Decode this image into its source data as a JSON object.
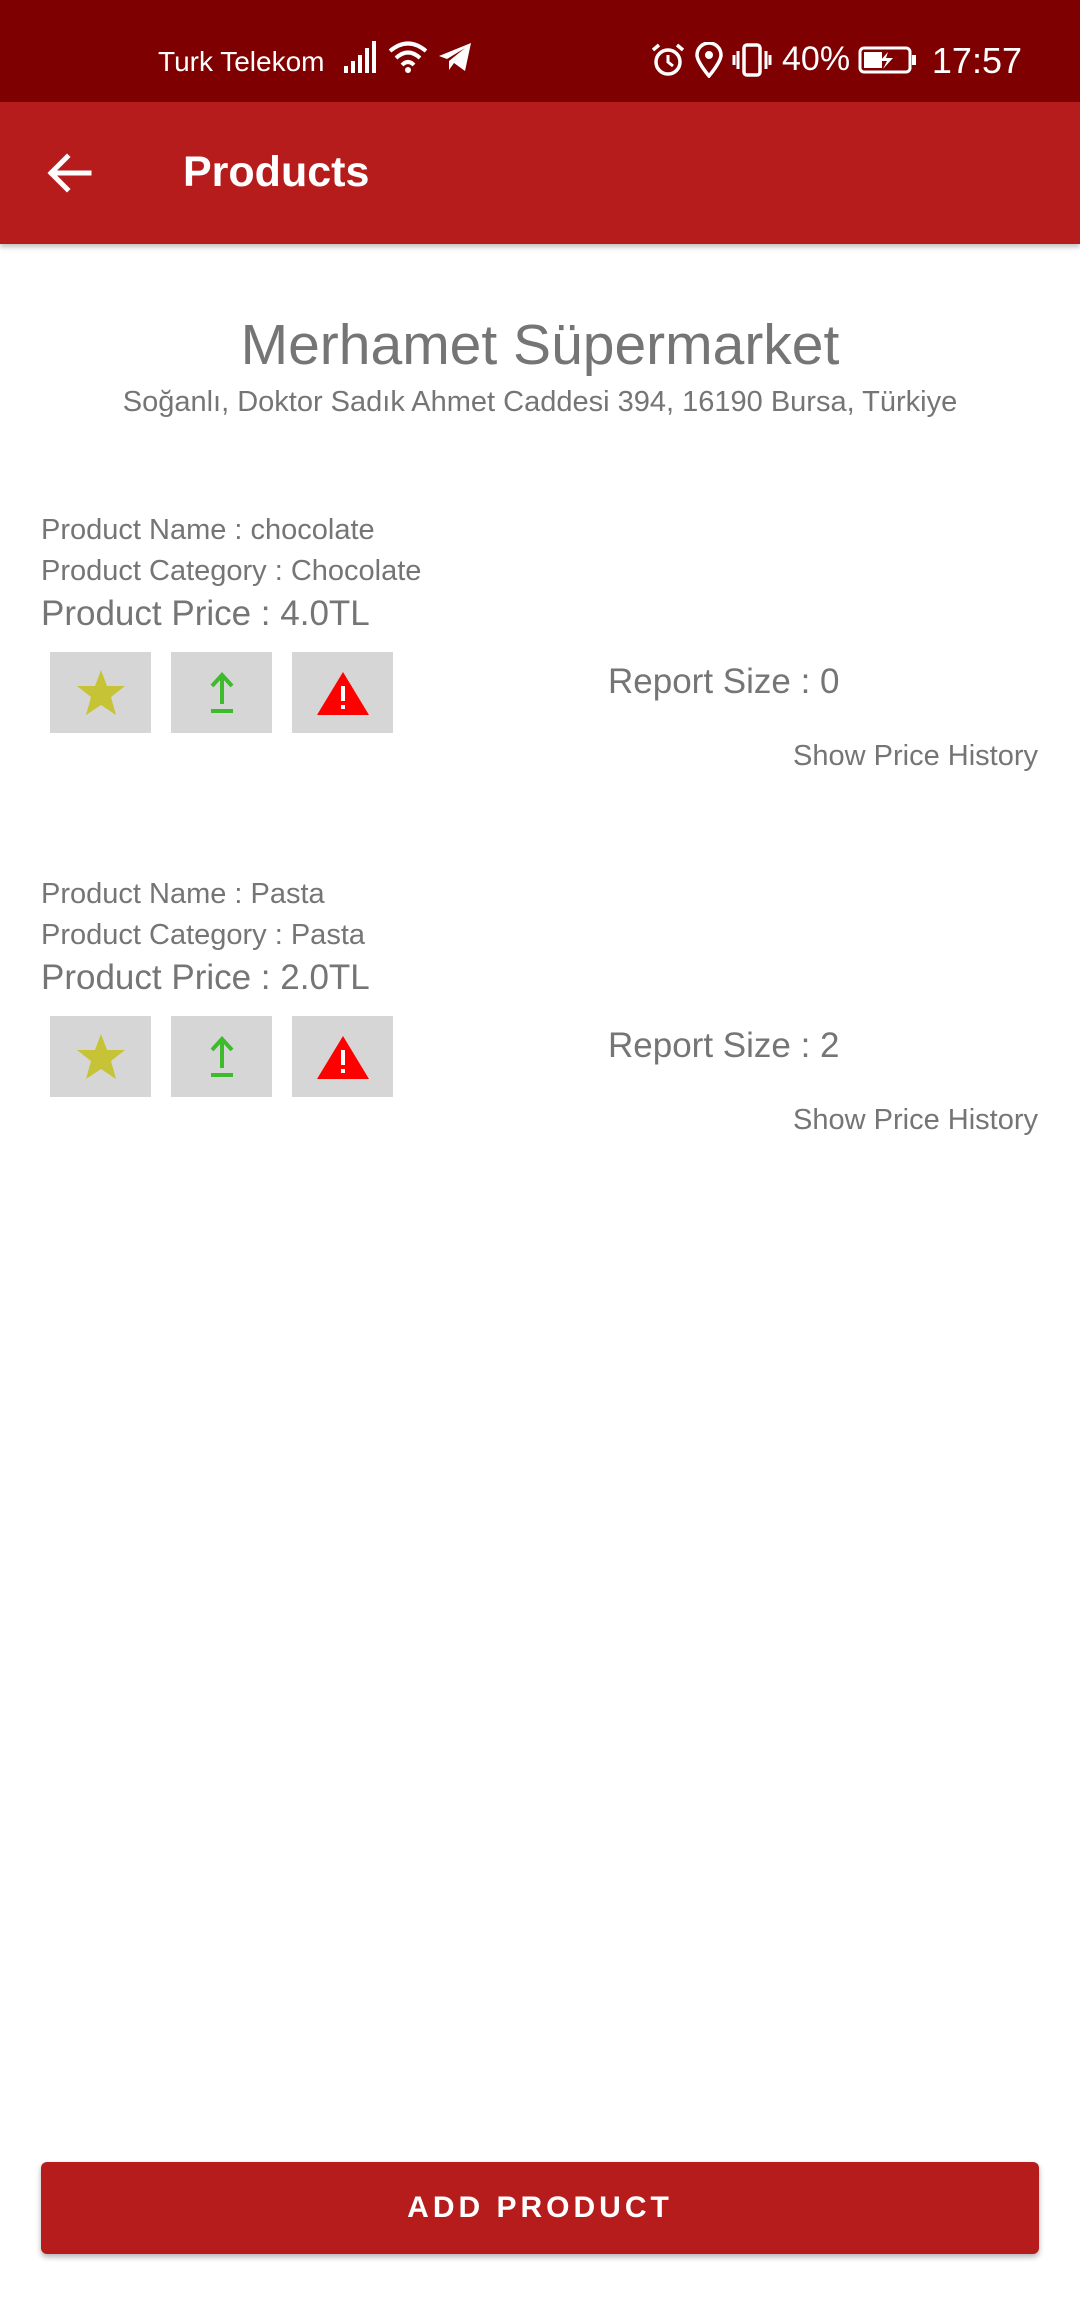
{
  "status_bar": {
    "carrier": "Turk Telekom",
    "battery_percent": "40%",
    "time": "17:57",
    "icons": [
      "signal-icon",
      "wifi-icon",
      "telegram-icon",
      "alarm-icon",
      "location-icon",
      "vibrate-icon",
      "battery-charging-icon"
    ]
  },
  "app_bar": {
    "back_icon": "arrow-left-icon",
    "title": "Products"
  },
  "store": {
    "name": "Merhamet Süpermarket",
    "address": "Soğanlı, Doktor Sadık Ahmet Caddesi 394, 16190 Bursa, Türkiye"
  },
  "products": [
    {
      "name": "Product Name : chocolate",
      "category": "Product Category : Chocolate",
      "price": "Product Price : 4.0TL",
      "report_size": "Report Size : 0",
      "price_history": "Show Price History"
    },
    {
      "name": "Product Name : Pasta",
      "category": "Product Category : Pasta",
      "price": "Product Price : 2.0TL",
      "report_size": "Report Size : 2",
      "price_history": "Show Price History"
    }
  ],
  "action_icons": [
    "star-icon",
    "upload-icon",
    "warning-icon"
  ],
  "colors": {
    "status_bar": "#7e0000",
    "app_bar": "#b71c1c",
    "star": "#c6c337",
    "upload": "#3dbb2c",
    "warning": "#ff0000",
    "text": "#757575"
  },
  "add_product_label": "ADD PRODUCT"
}
